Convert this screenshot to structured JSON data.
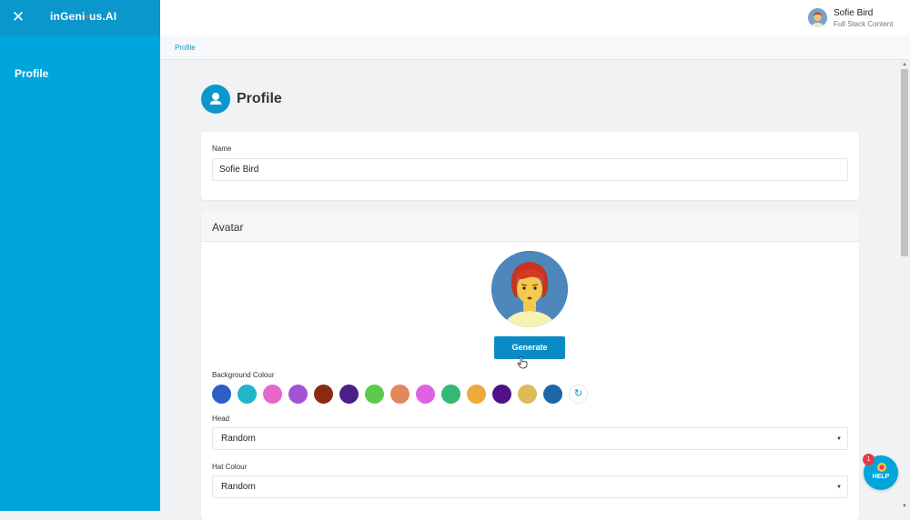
{
  "sidebar": {
    "logo_text_a": "inGeni",
    "logo_text_dot": "•",
    "logo_text_b": "us.AI",
    "close_icon": "close-icon",
    "items": [
      {
        "label": "Profile"
      }
    ]
  },
  "header": {
    "user_name": "Sofie Bird",
    "user_role": "Full Stack Content"
  },
  "breadcrumb": {
    "current": "Profile"
  },
  "page": {
    "title": "Profile",
    "icon": "user-icon"
  },
  "name_card": {
    "label": "Name",
    "value": "Sofie Bird"
  },
  "avatar_card": {
    "title": "Avatar",
    "generate_label": "Generate",
    "bg_label": "Background Colour",
    "swatches": [
      "#2f5ec9",
      "#22b5c8",
      "#e865c9",
      "#a155d6",
      "#8c2b12",
      "#4a1f8a",
      "#5ccb4b",
      "#e0875b",
      "#df62e0",
      "#34b872",
      "#efa83a",
      "#4f118a",
      "#dcbc57",
      "#1d66a8"
    ],
    "head_label": "Head",
    "head_value": "Random",
    "hat_label": "Hat Colour",
    "hat_value": "Random"
  },
  "help": {
    "label": "HELP",
    "badge": "1"
  },
  "colors": {
    "brand": "#00a5dc",
    "button": "#0a8bc5"
  }
}
